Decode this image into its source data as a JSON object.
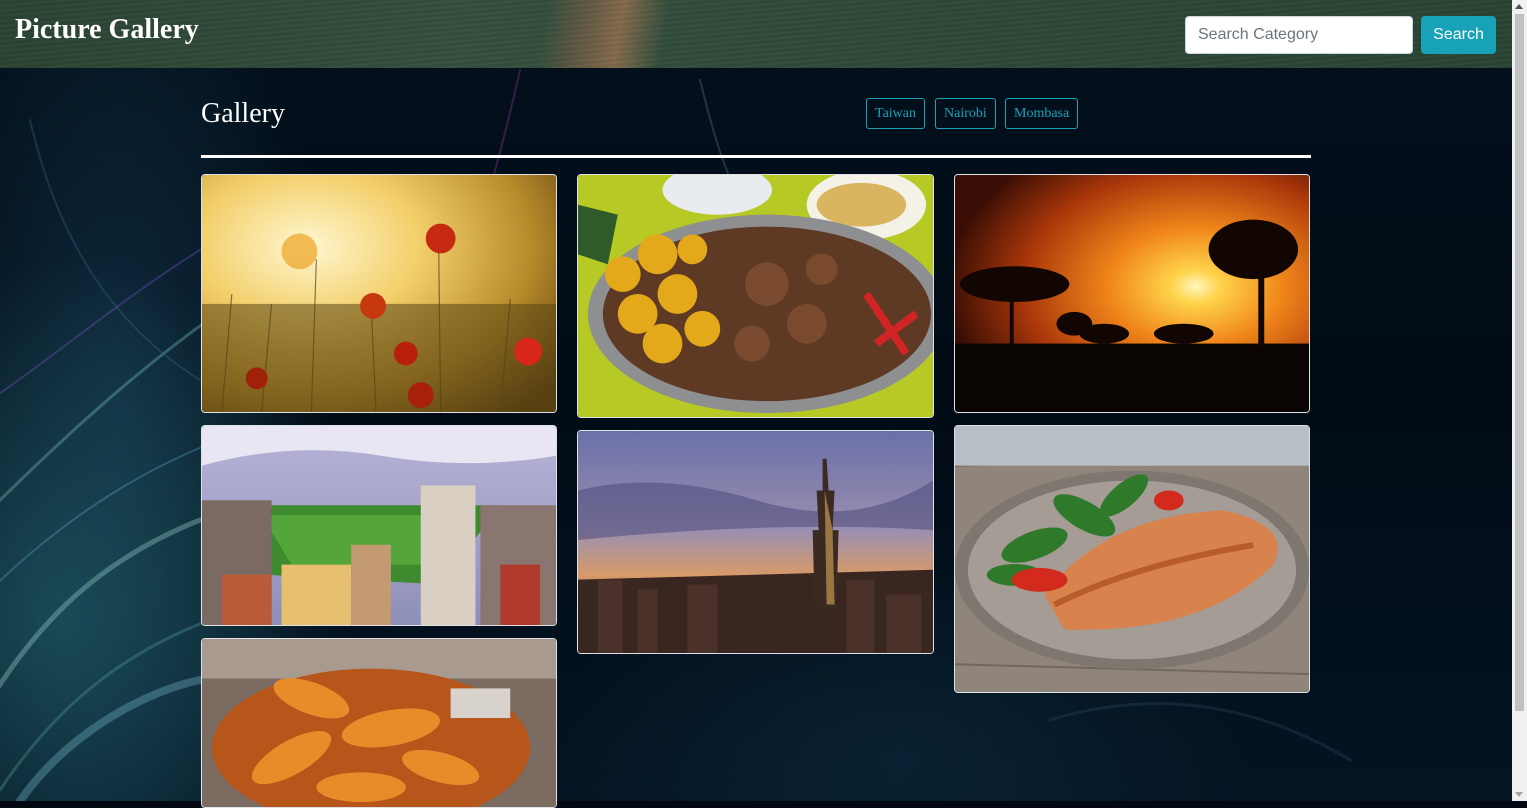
{
  "navbar": {
    "brand": "Picture Gallery",
    "search_placeholder": "Search Category",
    "search_button": "Search"
  },
  "main": {
    "heading": "Gallery",
    "categories": [
      "Taiwan",
      "Nairobi",
      "Mombasa"
    ]
  },
  "gallery": {
    "images": [
      {
        "subject": "poppy-field-sunset"
      },
      {
        "subject": "grilled-meat-platter"
      },
      {
        "subject": "savanna-sunset-acacia"
      },
      {
        "subject": "city-park-aerial"
      },
      {
        "subject": "taipei-101-skyline"
      },
      {
        "subject": "grilled-salmon-salad"
      },
      {
        "subject": "chicken-wings"
      }
    ]
  },
  "colors": {
    "accent": "#17a2b8",
    "navbar": "#2f4a38",
    "page_bg": "#020812"
  }
}
